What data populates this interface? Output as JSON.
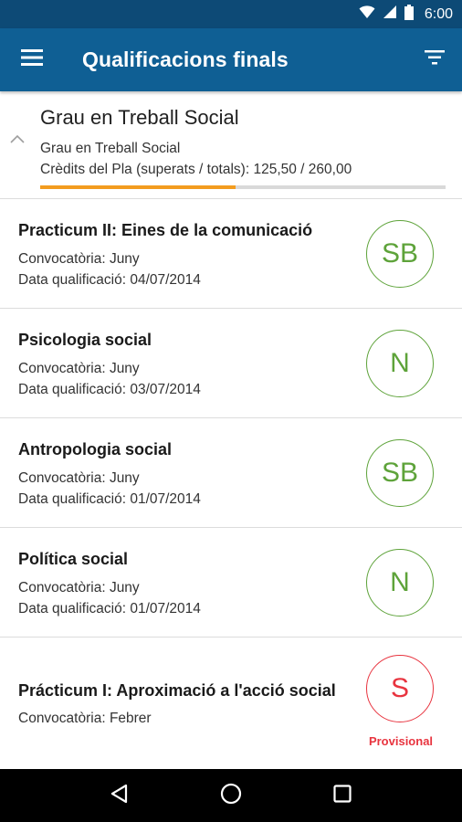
{
  "status_bar": {
    "time": "6:00"
  },
  "app_bar": {
    "title": "Qualificacions finals"
  },
  "degree": {
    "title": "Grau en Treball Social",
    "subtitle": "Grau en Treball Social",
    "credits_text": "Crèdits del Pla (superats / totals): 125,50 / 260,00",
    "credits_passed": 125.5,
    "credits_total": 260.0
  },
  "grades": [
    {
      "subject": "Practicum II: Eines de la comunicació",
      "convocatoria": "Convocatòria: Juny",
      "date": "Data qualificació: 04/07/2014",
      "grade": "SB"
    },
    {
      "subject": "Psicologia social",
      "convocatoria": "Convocatòria: Juny",
      "date": "Data qualificació: 03/07/2014",
      "grade": "N"
    },
    {
      "subject": "Antropologia social",
      "convocatoria": "Convocatòria: Juny",
      "date": "Data qualificació: 01/07/2014",
      "grade": "SB"
    },
    {
      "subject": "Política social",
      "convocatoria": "Convocatòria: Juny",
      "date": "Data qualificació: 01/07/2014",
      "grade": "N"
    },
    {
      "subject": "Prácticum I: Aproximació a l'acció social",
      "convocatoria": "Convocatòria: Febrer",
      "grade": "S",
      "status": "Provisional"
    }
  ],
  "colors": {
    "app_bar": "#0f5f94",
    "status_bar": "#0d4a76",
    "grade_ok": "#5ea33a",
    "grade_provisional": "#e8343f",
    "progress": "#f39c1f"
  },
  "icons": {
    "menu": "hamburger-menu-icon",
    "filter": "filter-icon",
    "collapse": "chevron-up-icon",
    "nav_back": "back-icon",
    "nav_home": "home-icon",
    "nav_recents": "recents-icon"
  }
}
